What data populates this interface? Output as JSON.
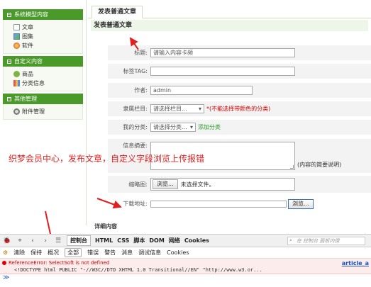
{
  "sidebar": {
    "groups": [
      {
        "title": "系统模型内容",
        "items": [
          {
            "label": "文章",
            "icon": "document-icon"
          },
          {
            "label": "图集",
            "icon": "image-icon"
          },
          {
            "label": "软件",
            "icon": "software-icon"
          }
        ]
      },
      {
        "title": "自定义内容",
        "items": [
          {
            "label": "商品",
            "icon": "goods-icon"
          },
          {
            "label": "分类信息",
            "icon": "chart-icon"
          }
        ]
      },
      {
        "title": "其他管理",
        "items": [
          {
            "label": "附件管理",
            "icon": "attachment-icon"
          }
        ]
      }
    ]
  },
  "main": {
    "tab": "发表普通文章",
    "section_title": "发表普通文章",
    "form": {
      "title_label": "标题:",
      "title_value": "请输入内容卡频",
      "tags_label": "标签TAG:",
      "tags_value": "",
      "author_label": "作者:",
      "author_value": "admin",
      "column_label": "隶属栏目:",
      "column_value": "请选择栏目...",
      "column_note": "*(不能选择带颜色的分类)",
      "mycat_label": "我的分类:",
      "mycat_value": "请选择分类...",
      "mycat_link": "添加分类",
      "summary_label": "信息摘要:",
      "summary_note": "(内容的简要说明)",
      "thumb_label": "缩略图:",
      "thumb_button": "浏览...",
      "thumb_status": "未选择文件。",
      "download_label": "下载地址:",
      "download_button": "浏览..."
    },
    "detail_title": "详细内容"
  },
  "annotation": "织梦会员中心，发布文章，自定义字段浏览上传报错",
  "devtools": {
    "tabs": [
      "控制台",
      "HTML",
      "CSS",
      "脚本",
      "DOM",
      "网络",
      "Cookies"
    ],
    "active_tab": "控制台",
    "search_placeholder": "在 控制台 面板内搜",
    "filters": [
      "清除",
      "保持",
      "概况",
      "全部",
      "错误",
      "警告",
      "消息",
      "调试信息",
      "Cookies"
    ],
    "active_filter": "全部",
    "error_message": "ReferenceError: SelectSoft is not defined",
    "error_source_line": "<!DOCTYPE html PUBLIC \"-//W3C//DTD XHTML 1.0 Transitional//EN\" \"http://www.w3.or...",
    "error_file": "article_a",
    "prompt": "≫"
  }
}
